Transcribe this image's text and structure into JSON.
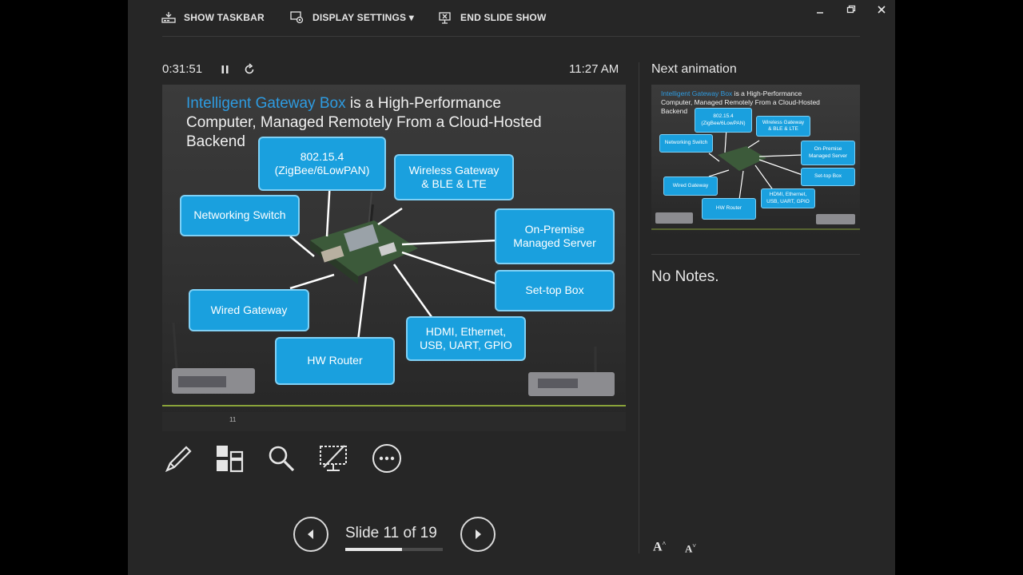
{
  "toolbar": {
    "show_taskbar": "SHOW TASKBAR",
    "display_settings": "DISPLAY SETTINGS ▾",
    "end_slide_show": "END SLIDE SHOW"
  },
  "presenter": {
    "elapsed_time": "0:31:51",
    "clock": "11:27 AM",
    "slide_counter": "Slide 11 of 19",
    "progress": 0.58
  },
  "slide": {
    "title_highlight": "Intelligent Gateway Box",
    "title_rest_line1": " is a High-Performance",
    "title_line2": "Computer, Managed Remotely From a Cloud-Hosted",
    "title_line3": "Backend",
    "callouts": {
      "zigbee_line1": "802.15.4",
      "zigbee_line2": "(ZigBee/6LowPAN)",
      "wireless_line1": "Wireless Gateway",
      "wireless_line2": "& BLE & LTE",
      "networking": "Networking Switch",
      "onprem_line1": "On-Premise",
      "onprem_line2": "Managed Server",
      "settop": "Set-top Box",
      "wired": "Wired Gateway",
      "hdmi_line1": "HDMI, Ethernet,",
      "hdmi_line2": "USB, UART, GPIO",
      "router": "HW Router"
    },
    "page_marker": "11"
  },
  "next_panel": {
    "heading": "Next animation"
  },
  "notes": {
    "text": "No Notes."
  },
  "font_buttons": {
    "increase": "A",
    "decrease": "A"
  },
  "colors": {
    "accent": "#1aa0de",
    "title_highlight": "#2e9be0",
    "background": "#262626"
  }
}
